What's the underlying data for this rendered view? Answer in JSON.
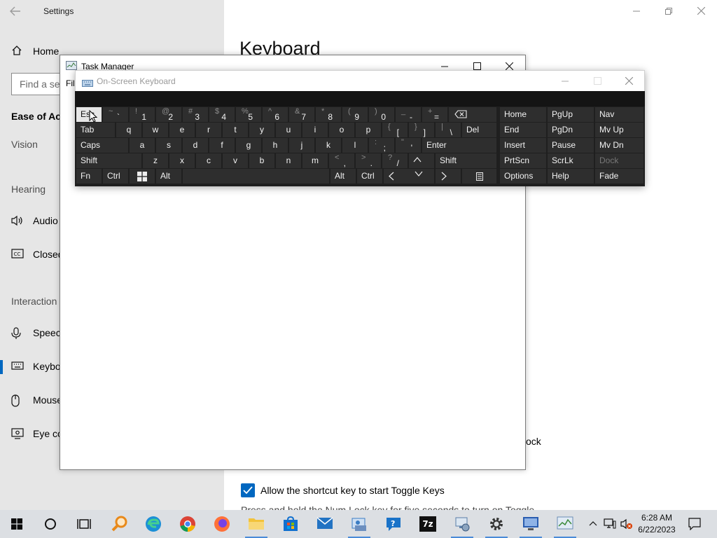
{
  "settings": {
    "title": "Settings",
    "home_label": "Home",
    "search_placeholder": "Find a set",
    "section_title": "Ease of Acc",
    "groups": {
      "vision": "Vision",
      "hearing": "Hearing",
      "interaction": "Interaction"
    },
    "items": [
      {
        "label": "Audio",
        "icon": "speaker-icon"
      },
      {
        "label": "Closed",
        "icon": "cc-icon"
      },
      {
        "label": "Speech",
        "icon": "microphone-icon"
      },
      {
        "label": "Keybo",
        "icon": "keyboard-icon",
        "active": true
      },
      {
        "label": "Mouse",
        "icon": "mouse-icon"
      },
      {
        "label": "Eye co",
        "icon": "eye-control-icon"
      }
    ],
    "page_title": "Keyboard",
    "lock_text": "ock",
    "toggle_keys_checkbox_label": "Allow the shortcut key to start Toggle Keys",
    "toggle_keys_checked": true,
    "partial_text": "Press and hold the Num Lock key for five seconds to turn on Toggle"
  },
  "task_manager": {
    "title": "Task Manager",
    "menu_partial": "File"
  },
  "osk": {
    "title": "On-Screen Keyboard",
    "rows": [
      [
        {
          "id": "esc",
          "main": "Esc"
        },
        {
          "id": "grave",
          "up": "~",
          "lo": "`"
        },
        {
          "id": "1",
          "up": "!",
          "lo": "1"
        },
        {
          "id": "2",
          "up": "@",
          "lo": "2"
        },
        {
          "id": "3",
          "up": "#",
          "lo": "3"
        },
        {
          "id": "4",
          "up": "$",
          "lo": "4"
        },
        {
          "id": "5",
          "up": "%",
          "lo": "5"
        },
        {
          "id": "6",
          "up": "^",
          "lo": "6"
        },
        {
          "id": "7",
          "up": "&",
          "lo": "7"
        },
        {
          "id": "8",
          "up": "*",
          "lo": "8"
        },
        {
          "id": "9",
          "up": "(",
          "lo": "9"
        },
        {
          "id": "0",
          "up": ")",
          "lo": "0"
        },
        {
          "id": "minus",
          "up": "_",
          "lo": "-"
        },
        {
          "id": "equals",
          "up": "+",
          "lo": "="
        },
        {
          "id": "backspace",
          "icon": "backspace-icon"
        }
      ],
      [
        {
          "id": "tab",
          "main": "Tab"
        },
        {
          "id": "q",
          "main": "q"
        },
        {
          "id": "w",
          "main": "w"
        },
        {
          "id": "e",
          "main": "e"
        },
        {
          "id": "r",
          "main": "r"
        },
        {
          "id": "t",
          "main": "t"
        },
        {
          "id": "y",
          "main": "y"
        },
        {
          "id": "u",
          "main": "u"
        },
        {
          "id": "i",
          "main": "i"
        },
        {
          "id": "o",
          "main": "o"
        },
        {
          "id": "p",
          "main": "p"
        },
        {
          "id": "lbracket",
          "up": "{",
          "lo": "["
        },
        {
          "id": "rbracket",
          "up": "}",
          "lo": "]"
        },
        {
          "id": "backslash",
          "up": "|",
          "lo": "\\"
        },
        {
          "id": "del",
          "main": "Del"
        }
      ],
      [
        {
          "id": "caps",
          "main": "Caps"
        },
        {
          "id": "a",
          "main": "a"
        },
        {
          "id": "s",
          "main": "s"
        },
        {
          "id": "d",
          "main": "d"
        },
        {
          "id": "f",
          "main": "f"
        },
        {
          "id": "g",
          "main": "g"
        },
        {
          "id": "h",
          "main": "h"
        },
        {
          "id": "j",
          "main": "j"
        },
        {
          "id": "k",
          "main": "k"
        },
        {
          "id": "l",
          "main": "l"
        },
        {
          "id": "semicolon",
          "up": ":",
          "lo": ";"
        },
        {
          "id": "quote",
          "up": "\"",
          "lo": "'"
        },
        {
          "id": "enter",
          "main": "Enter"
        }
      ],
      [
        {
          "id": "lshift",
          "main": "Shift"
        },
        {
          "id": "z",
          "main": "z"
        },
        {
          "id": "x",
          "main": "x"
        },
        {
          "id": "c",
          "main": "c"
        },
        {
          "id": "v",
          "main": "v"
        },
        {
          "id": "b",
          "main": "b"
        },
        {
          "id": "n",
          "main": "n"
        },
        {
          "id": "m",
          "main": "m"
        },
        {
          "id": "comma",
          "up": "<",
          "lo": ","
        },
        {
          "id": "period",
          "up": ">",
          "lo": "."
        },
        {
          "id": "slash",
          "up": "?",
          "lo": "/"
        },
        {
          "id": "up",
          "icon": "arrow-up-icon"
        },
        {
          "id": "rshift",
          "main": "Shift"
        }
      ],
      [
        {
          "id": "fn",
          "main": "Fn"
        },
        {
          "id": "lctrl",
          "main": "Ctrl"
        },
        {
          "id": "win",
          "icon": "windows-icon"
        },
        {
          "id": "lalt",
          "main": "Alt"
        },
        {
          "id": "space",
          "main": ""
        },
        {
          "id": "ralt",
          "main": "Alt"
        },
        {
          "id": "rctrl",
          "main": "Ctrl"
        },
        {
          "id": "left",
          "icon": "arrow-left-icon"
        },
        {
          "id": "down",
          "icon": "arrow-down-icon"
        },
        {
          "id": "right",
          "icon": "arrow-right-icon"
        },
        {
          "id": "menu",
          "icon": "context-menu-icon"
        }
      ]
    ],
    "nav_keys": [
      [
        "Home",
        "PgUp",
        "Nav"
      ],
      [
        "End",
        "PgDn",
        "Mv Up"
      ],
      [
        "Insert",
        "Pause",
        "Mv Dn"
      ],
      [
        "PrtScn",
        "ScrLk",
        "Dock"
      ],
      [
        "Options",
        "Help",
        "Fade"
      ]
    ],
    "dim_keys": [
      "Dock"
    ]
  },
  "taskbar": {
    "icons": [
      {
        "name": "start-button",
        "icon": "windows-logo-icon",
        "color": "#0078d4"
      },
      {
        "name": "cortana-button",
        "icon": "circle-icon",
        "color": "#111111"
      },
      {
        "name": "task-view-button",
        "icon": "task-view-icon",
        "color": "#111111"
      },
      {
        "name": "taskbar-search-app",
        "icon": "magnifier-icon",
        "color": "#e8891a"
      },
      {
        "name": "taskbar-edge",
        "icon": "edge-icon",
        "color": "#1b8fd6"
      },
      {
        "name": "taskbar-chrome",
        "icon": "chrome-icon",
        "color": "#db4437"
      },
      {
        "name": "taskbar-firefox",
        "icon": "firefox-icon",
        "color": "#ff7139"
      },
      {
        "name": "taskbar-file-explorer",
        "icon": "folder-icon",
        "color": "#f2c23b"
      },
      {
        "name": "taskbar-store",
        "icon": "store-icon",
        "color": "#1170cf"
      },
      {
        "name": "taskbar-mail",
        "icon": "mail-icon",
        "color": "#2273c3"
      },
      {
        "name": "taskbar-control-panel",
        "icon": "control-panel-icon",
        "color": "#3b7dc4"
      },
      {
        "name": "taskbar-get-help",
        "icon": "help-icon",
        "color": "#1a73c8"
      },
      {
        "name": "taskbar-7zip",
        "icon": "7zip-icon",
        "color": "#111111",
        "text": "7z"
      },
      {
        "name": "taskbar-device-manager",
        "icon": "device-manager-icon",
        "color": "#5a7ea8"
      },
      {
        "name": "taskbar-settings",
        "icon": "gear-icon",
        "color": "#333333"
      },
      {
        "name": "taskbar-remote-app",
        "icon": "remote-desktop-icon",
        "color": "#2a5db0"
      },
      {
        "name": "taskbar-task-manager",
        "icon": "task-manager-icon",
        "color": "#6b8eb5"
      }
    ],
    "time": "6:28 AM",
    "date": "6/22/2023"
  }
}
